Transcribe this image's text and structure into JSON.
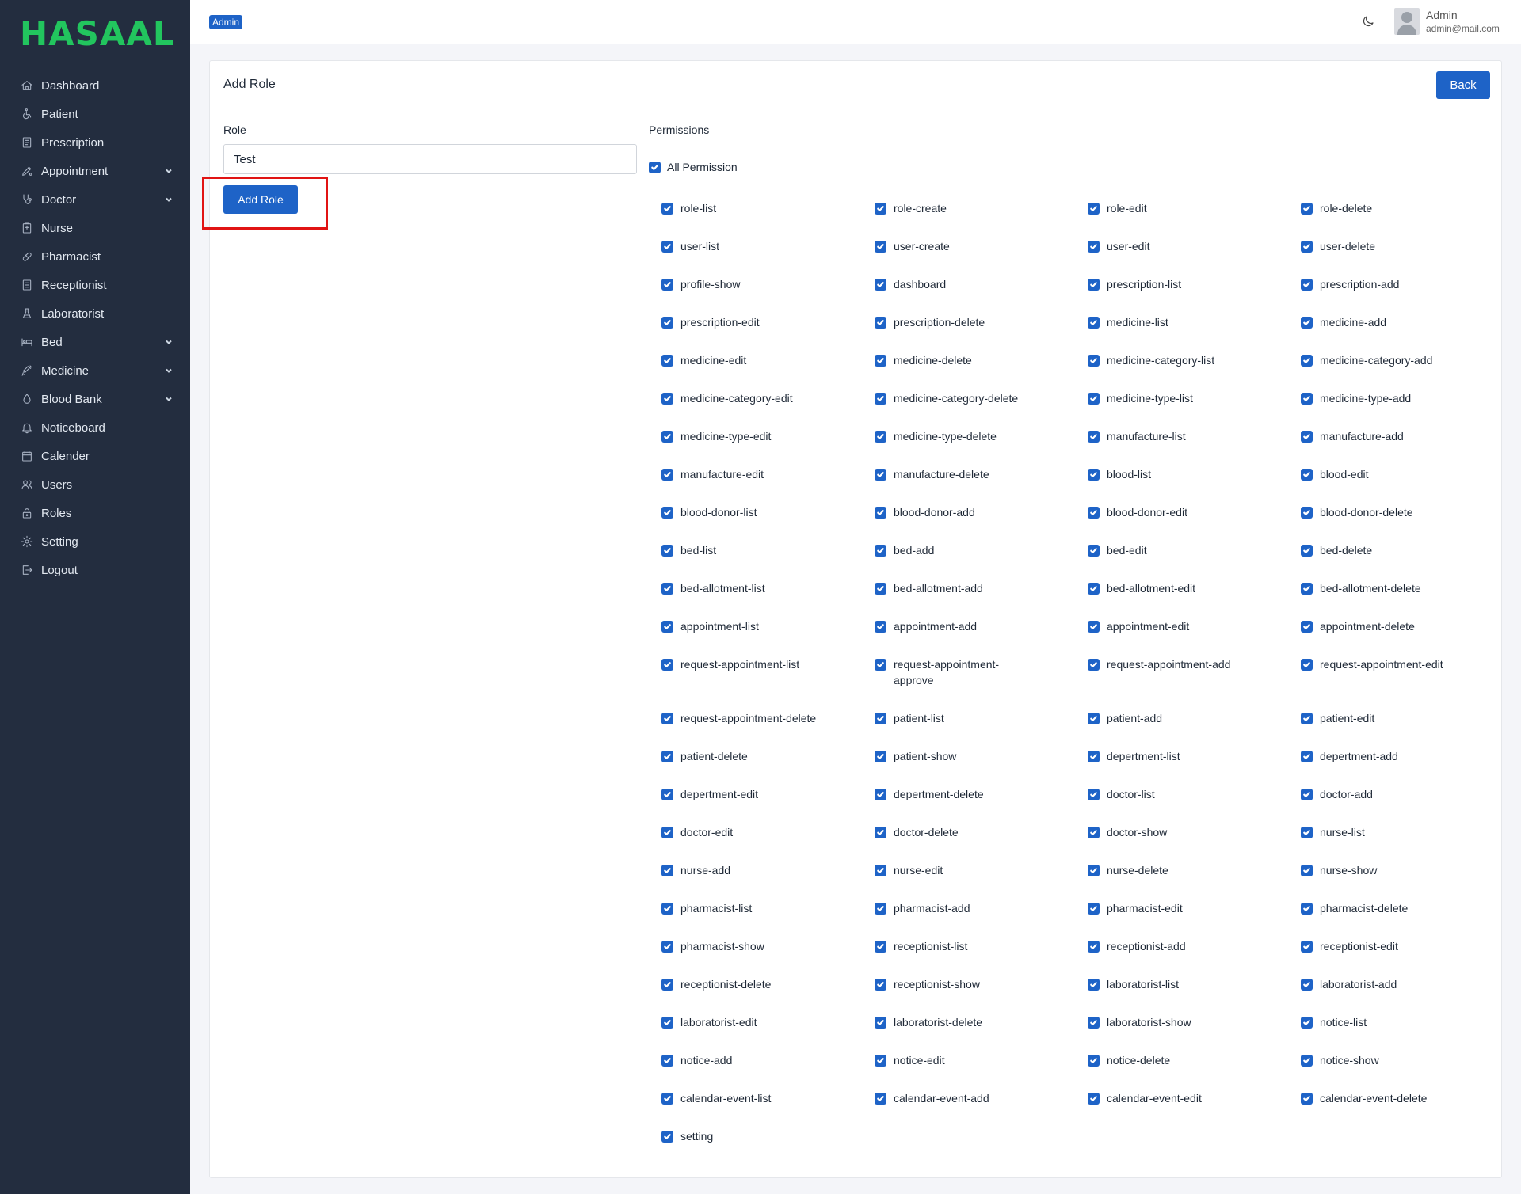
{
  "brand": "HASAAL",
  "nav": [
    {
      "label": "Dashboard",
      "icon": "home-icon",
      "chevron": false
    },
    {
      "label": "Patient",
      "icon": "wheelchair-icon",
      "chevron": false
    },
    {
      "label": "Prescription",
      "icon": "document-icon",
      "chevron": false
    },
    {
      "label": "Appointment",
      "icon": "pen-icon",
      "chevron": true
    },
    {
      "label": "Doctor",
      "icon": "stethoscope-icon",
      "chevron": true
    },
    {
      "label": "Nurse",
      "icon": "clipboard-icon",
      "chevron": false
    },
    {
      "label": "Pharmacist",
      "icon": "pill-icon",
      "chevron": false
    },
    {
      "label": "Receptionist",
      "icon": "receipt-icon",
      "chevron": false
    },
    {
      "label": "Laboratorist",
      "icon": "flask-icon",
      "chevron": false
    },
    {
      "label": "Bed",
      "icon": "bed-icon",
      "chevron": true
    },
    {
      "label": "Medicine",
      "icon": "syringe-icon",
      "chevron": true
    },
    {
      "label": "Blood Bank",
      "icon": "droplet-icon",
      "chevron": true
    },
    {
      "label": "Noticeboard",
      "icon": "bell-icon",
      "chevron": false
    },
    {
      "label": "Calender",
      "icon": "calendar-icon",
      "chevron": false
    },
    {
      "label": "Users",
      "icon": "users-icon",
      "chevron": false
    },
    {
      "label": "Roles",
      "icon": "lock-icon",
      "chevron": false
    },
    {
      "label": "Setting",
      "icon": "gear-icon",
      "chevron": false
    },
    {
      "label": "Logout",
      "icon": "logout-icon",
      "chevron": false
    }
  ],
  "header": {
    "badge": "Admin",
    "user_name": "Admin",
    "user_email": "admin@mail.com"
  },
  "card": {
    "title": "Add Role",
    "back_label": "Back"
  },
  "form": {
    "role_label": "Role",
    "role_value": "Test",
    "submit_label": "Add Role",
    "permissions_label": "Permissions",
    "all_permission_label": "All Permission",
    "all_permission_checked": true
  },
  "permissions": [
    "role-list",
    "role-create",
    "role-edit",
    "role-delete",
    "user-list",
    "user-create",
    "user-edit",
    "user-delete",
    "profile-show",
    "dashboard",
    "prescription-list",
    "prescription-add",
    "prescription-edit",
    "prescription-delete",
    "medicine-list",
    "medicine-add",
    "medicine-edit",
    "medicine-delete",
    "medicine-category-list",
    "medicine-category-add",
    "medicine-category-edit",
    "medicine-category-delete",
    "medicine-type-list",
    "medicine-type-add",
    "medicine-type-edit",
    "medicine-type-delete",
    "manufacture-list",
    "manufacture-add",
    "manufacture-edit",
    "manufacture-delete",
    "blood-list",
    "blood-edit",
    "blood-donor-list",
    "blood-donor-add",
    "blood-donor-edit",
    "blood-donor-delete",
    "bed-list",
    "bed-add",
    "bed-edit",
    "bed-delete",
    "bed-allotment-list",
    "bed-allotment-add",
    "bed-allotment-edit",
    "bed-allotment-delete",
    "appointment-list",
    "appointment-add",
    "appointment-edit",
    "appointment-delete",
    "request-appointment-list",
    "request-appointment-approve",
    "request-appointment-add",
    "request-appointment-edit",
    "request-appointment-delete",
    "patient-list",
    "patient-add",
    "patient-edit",
    "patient-delete",
    "patient-show",
    "depertment-list",
    "depertment-add",
    "depertment-edit",
    "depertment-delete",
    "doctor-list",
    "doctor-add",
    "doctor-edit",
    "doctor-delete",
    "doctor-show",
    "nurse-list",
    "nurse-add",
    "nurse-edit",
    "nurse-delete",
    "nurse-show",
    "pharmacist-list",
    "pharmacist-add",
    "pharmacist-edit",
    "pharmacist-delete",
    "pharmacist-show",
    "receptionist-list",
    "receptionist-add",
    "receptionist-edit",
    "receptionist-delete",
    "receptionist-show",
    "laboratorist-list",
    "laboratorist-add",
    "laboratorist-edit",
    "laboratorist-delete",
    "laboratorist-show",
    "notice-list",
    "notice-add",
    "notice-edit",
    "notice-delete",
    "notice-show",
    "calendar-event-list",
    "calendar-event-add",
    "calendar-event-edit",
    "calendar-event-delete",
    "setting"
  ],
  "colors": {
    "sidebar": "#232d3f",
    "brand": "#22c55e",
    "primary": "#1e63c7",
    "highlight": "#e11414"
  }
}
